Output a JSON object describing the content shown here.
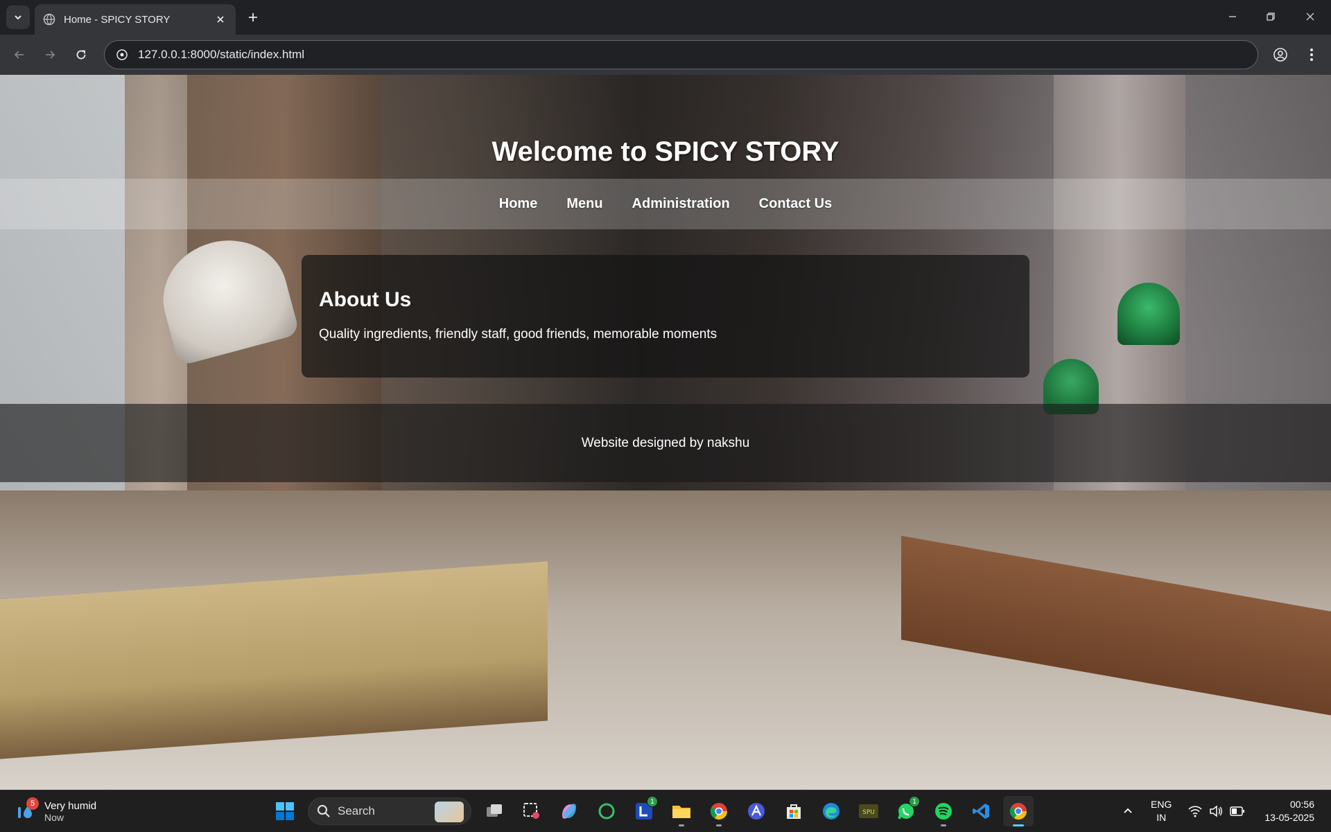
{
  "browser": {
    "tab_title": "Home - SPICY STORY",
    "url": "127.0.0.1:8000/static/index.html",
    "icons": [
      "tab-search-icon",
      "globe-icon",
      "close-icon",
      "plus-icon",
      "minimize-icon",
      "restore-icon",
      "window-close-icon",
      "back-icon",
      "forward-icon",
      "reload-icon",
      "site-info-icon",
      "profile-icon",
      "more-icon"
    ]
  },
  "site": {
    "title": "Welcome to SPICY STORY",
    "nav": [
      "Home",
      "Menu",
      "Administration",
      "Contact Us"
    ],
    "about": {
      "heading": "About Us",
      "text": "Quality ingredients, friendly staff, good friends, memorable moments"
    },
    "footer": "Website designed by nakshu"
  },
  "taskbar": {
    "weather_main": "Very humid",
    "weather_sub": "Now",
    "weather_badge": "5",
    "search_label": "Search",
    "apps": [
      {
        "name": "windows-start",
        "badge": ""
      },
      {
        "name": "task-view",
        "badge": ""
      },
      {
        "name": "snipping-tool",
        "badge": ""
      },
      {
        "name": "copilot",
        "badge": ""
      },
      {
        "name": "refresh-app",
        "badge": ""
      },
      {
        "name": "l-app",
        "badge": "1"
      },
      {
        "name": "file-explorer",
        "badge": ""
      },
      {
        "name": "chrome",
        "badge": ""
      },
      {
        "name": "arc-app",
        "badge": ""
      },
      {
        "name": "microsoft-store",
        "badge": ""
      },
      {
        "name": "edge",
        "badge": ""
      },
      {
        "name": "spu-app",
        "badge": ""
      },
      {
        "name": "whatsapp",
        "badge": "1"
      },
      {
        "name": "spotify",
        "badge": ""
      },
      {
        "name": "vscode",
        "badge": ""
      },
      {
        "name": "chrome-active",
        "badge": ""
      }
    ],
    "spu_label": "SPU",
    "lang_top": "ENG",
    "lang_bottom": "IN",
    "time": "00:56",
    "date": "13-05-2025"
  },
  "colors": {
    "chrome_dark": "#202124",
    "chrome_toolbar": "#35363a",
    "taskbar": "#1f1f1f",
    "accent": "#60cdff"
  }
}
